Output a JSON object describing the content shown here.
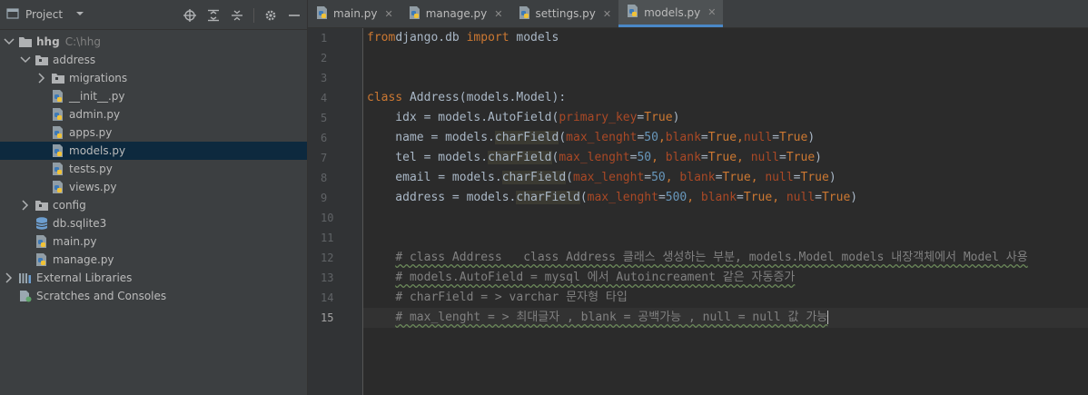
{
  "sidebar": {
    "title": "Project",
    "tree": [
      {
        "label": "hhg",
        "path": "C:\\hhg",
        "indent": 0,
        "arrow": "down",
        "icon": "folder",
        "bold": true
      },
      {
        "label": "address",
        "indent": 1,
        "arrow": "down",
        "icon": "package-folder"
      },
      {
        "label": "migrations",
        "indent": 2,
        "arrow": "right",
        "icon": "package-folder"
      },
      {
        "label": "__init__.py",
        "indent": 2,
        "icon": "python-file"
      },
      {
        "label": "admin.py",
        "indent": 2,
        "icon": "python-file"
      },
      {
        "label": "apps.py",
        "indent": 2,
        "icon": "python-file"
      },
      {
        "label": "models.py",
        "indent": 2,
        "icon": "python-file",
        "selected": true
      },
      {
        "label": "tests.py",
        "indent": 2,
        "icon": "python-file"
      },
      {
        "label": "views.py",
        "indent": 2,
        "icon": "python-file"
      },
      {
        "label": "config",
        "indent": 1,
        "arrow": "right",
        "icon": "package-folder"
      },
      {
        "label": "db.sqlite3",
        "indent": 1,
        "icon": "database"
      },
      {
        "label": "main.py",
        "indent": 1,
        "icon": "python-file"
      },
      {
        "label": "manage.py",
        "indent": 1,
        "icon": "python-file"
      },
      {
        "label": "External Libraries",
        "indent": 0,
        "arrow": "right",
        "icon": "library"
      },
      {
        "label": "Scratches and Consoles",
        "indent": 0,
        "icon": "scratches"
      }
    ]
  },
  "tabs": [
    {
      "label": "main.py"
    },
    {
      "label": "manage.py"
    },
    {
      "label": "settings.py"
    },
    {
      "label": "models.py",
      "active": true
    }
  ],
  "editor": {
    "current_line": 15,
    "lines": [
      {
        "n": 1,
        "tokens": [
          [
            "kw",
            "from"
          ],
          [
            "",
            "django.db "
          ],
          [
            "kw",
            "import"
          ],
          [
            "",
            " models"
          ]
        ]
      },
      {
        "n": 2,
        "tokens": []
      },
      {
        "n": 3,
        "tokens": []
      },
      {
        "n": 4,
        "tokens": [
          [
            "kw",
            "class"
          ],
          [
            "",
            " Address(models.Model):"
          ]
        ]
      },
      {
        "n": 5,
        "tokens": [
          [
            "",
            "    idx = models.AutoField("
          ],
          [
            "prm",
            "primary_key"
          ],
          [
            "",
            "="
          ],
          [
            "kw",
            "True"
          ],
          [
            "",
            ")"
          ]
        ]
      },
      {
        "n": 6,
        "tokens": [
          [
            "",
            "    name = models."
          ],
          [
            "hl",
            "charField"
          ],
          [
            "",
            "("
          ],
          [
            "prm",
            "max_lenght"
          ],
          [
            "",
            "="
          ],
          [
            "num",
            "50"
          ],
          [
            "kw",
            ","
          ],
          [
            "prm",
            "blank"
          ],
          [
            "",
            "="
          ],
          [
            "kw",
            "True"
          ],
          [
            "kw",
            ","
          ],
          [
            "prm",
            "null"
          ],
          [
            "",
            "="
          ],
          [
            "kw",
            "True"
          ],
          [
            "",
            ")"
          ]
        ]
      },
      {
        "n": 7,
        "tokens": [
          [
            "",
            "    tel = models."
          ],
          [
            "hl",
            "charField"
          ],
          [
            "",
            "("
          ],
          [
            "prm",
            "max_lenght"
          ],
          [
            "",
            "="
          ],
          [
            "num",
            "50"
          ],
          [
            "kw",
            ", "
          ],
          [
            "prm",
            "blank"
          ],
          [
            "",
            "="
          ],
          [
            "kw",
            "True"
          ],
          [
            "kw",
            ", "
          ],
          [
            "prm",
            "null"
          ],
          [
            "",
            "="
          ],
          [
            "kw",
            "True"
          ],
          [
            "",
            ")"
          ]
        ]
      },
      {
        "n": 8,
        "tokens": [
          [
            "",
            "    email = models."
          ],
          [
            "hl",
            "charField"
          ],
          [
            "",
            "("
          ],
          [
            "prm",
            "max_lenght"
          ],
          [
            "",
            "="
          ],
          [
            "num",
            "50"
          ],
          [
            "kw",
            ", "
          ],
          [
            "prm",
            "blank"
          ],
          [
            "",
            "="
          ],
          [
            "kw",
            "True"
          ],
          [
            "kw",
            ", "
          ],
          [
            "prm",
            "null"
          ],
          [
            "",
            "="
          ],
          [
            "kw",
            "True"
          ],
          [
            "",
            ")"
          ]
        ]
      },
      {
        "n": 9,
        "tokens": [
          [
            "",
            "    address = models."
          ],
          [
            "hl",
            "charField"
          ],
          [
            "",
            "("
          ],
          [
            "prm",
            "max_lenght"
          ],
          [
            "",
            "="
          ],
          [
            "num",
            "500"
          ],
          [
            "kw",
            ", "
          ],
          [
            "prm",
            "blank"
          ],
          [
            "",
            "="
          ],
          [
            "kw",
            "True"
          ],
          [
            "kw",
            ", "
          ],
          [
            "prm",
            "null"
          ],
          [
            "",
            "="
          ],
          [
            "kw",
            "True"
          ],
          [
            "",
            ")"
          ]
        ]
      },
      {
        "n": 10,
        "tokens": []
      },
      {
        "n": 11,
        "tokens": []
      },
      {
        "n": 12,
        "tokens": [
          [
            "",
            "    "
          ],
          [
            "cmt-u",
            "# class Address   class Address 클래스 생성하는 부분, models.Model models 내장객체에서 Model 사용"
          ]
        ]
      },
      {
        "n": 13,
        "tokens": [
          [
            "",
            "    "
          ],
          [
            "cmt-u",
            "# models.AutoField = mysql 에서 Autoincreament 같은 자동증가"
          ]
        ]
      },
      {
        "n": 14,
        "tokens": [
          [
            "",
            "    "
          ],
          [
            "cmt",
            "# charField = > varchar 문자형 타입"
          ]
        ]
      },
      {
        "n": 15,
        "tokens": [
          [
            "",
            "    "
          ],
          [
            "cmt-u",
            "# max_lenght = > 최대글자 , blank = 공백가능 , null = null 값 가능"
          ]
        ]
      }
    ]
  },
  "colors": {
    "accent": "#4a88c7",
    "selection": "#0d293e",
    "keyword": "#cc7832",
    "param": "#aa4926",
    "number": "#6897bb"
  }
}
